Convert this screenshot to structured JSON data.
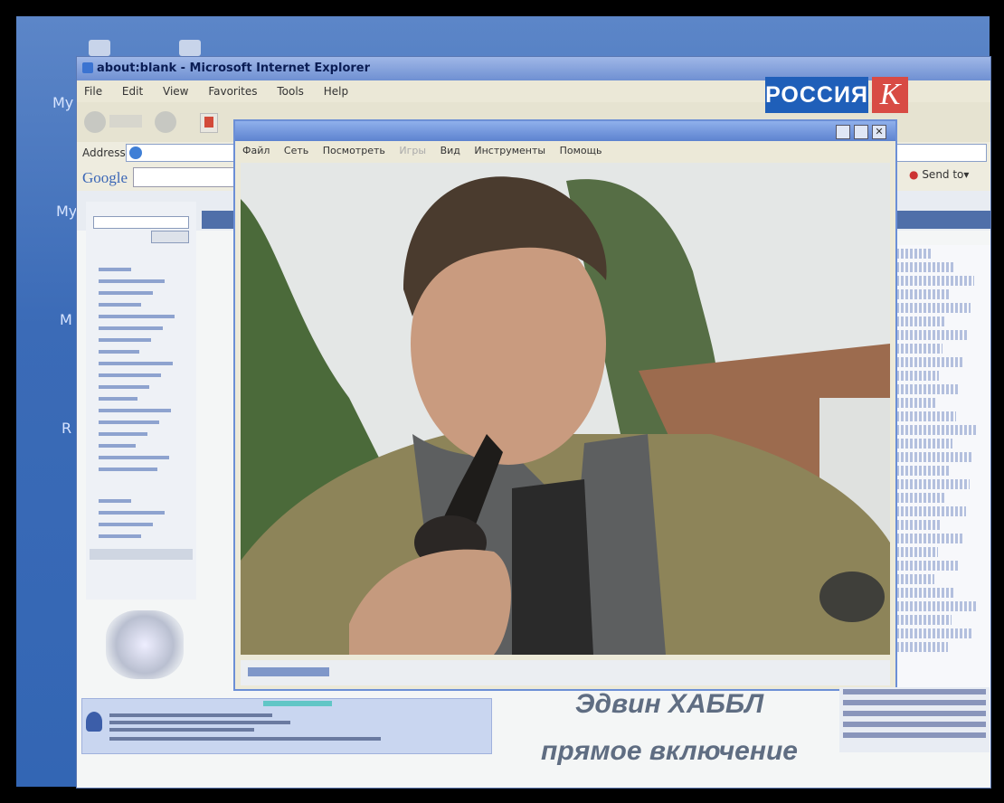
{
  "desktop": {
    "icon_labels": [
      "My",
      "My",
      "M",
      "R"
    ]
  },
  "ie": {
    "title": "about:blank - Microsoft Internet Explorer",
    "menu": [
      "File",
      "Edit",
      "View",
      "Favorites",
      "Tools",
      "Help"
    ],
    "address_label": "Address",
    "google_label": "Google",
    "send_to": "Send to"
  },
  "player": {
    "menu": [
      "Файл",
      "Сеть",
      "Посмотреть",
      "Игры",
      "Вид",
      "Инструменты",
      "Помощь"
    ]
  },
  "logo": {
    "text": "РОССИЯ",
    "letter": "К"
  },
  "caption": {
    "line1": "Эдвин ХАББЛ",
    "line2": "прямое включение"
  },
  "colors": {
    "logo_blue": "#1f5fb9",
    "logo_red": "#d84b44",
    "desktop_blue": "#3b6bb7"
  }
}
